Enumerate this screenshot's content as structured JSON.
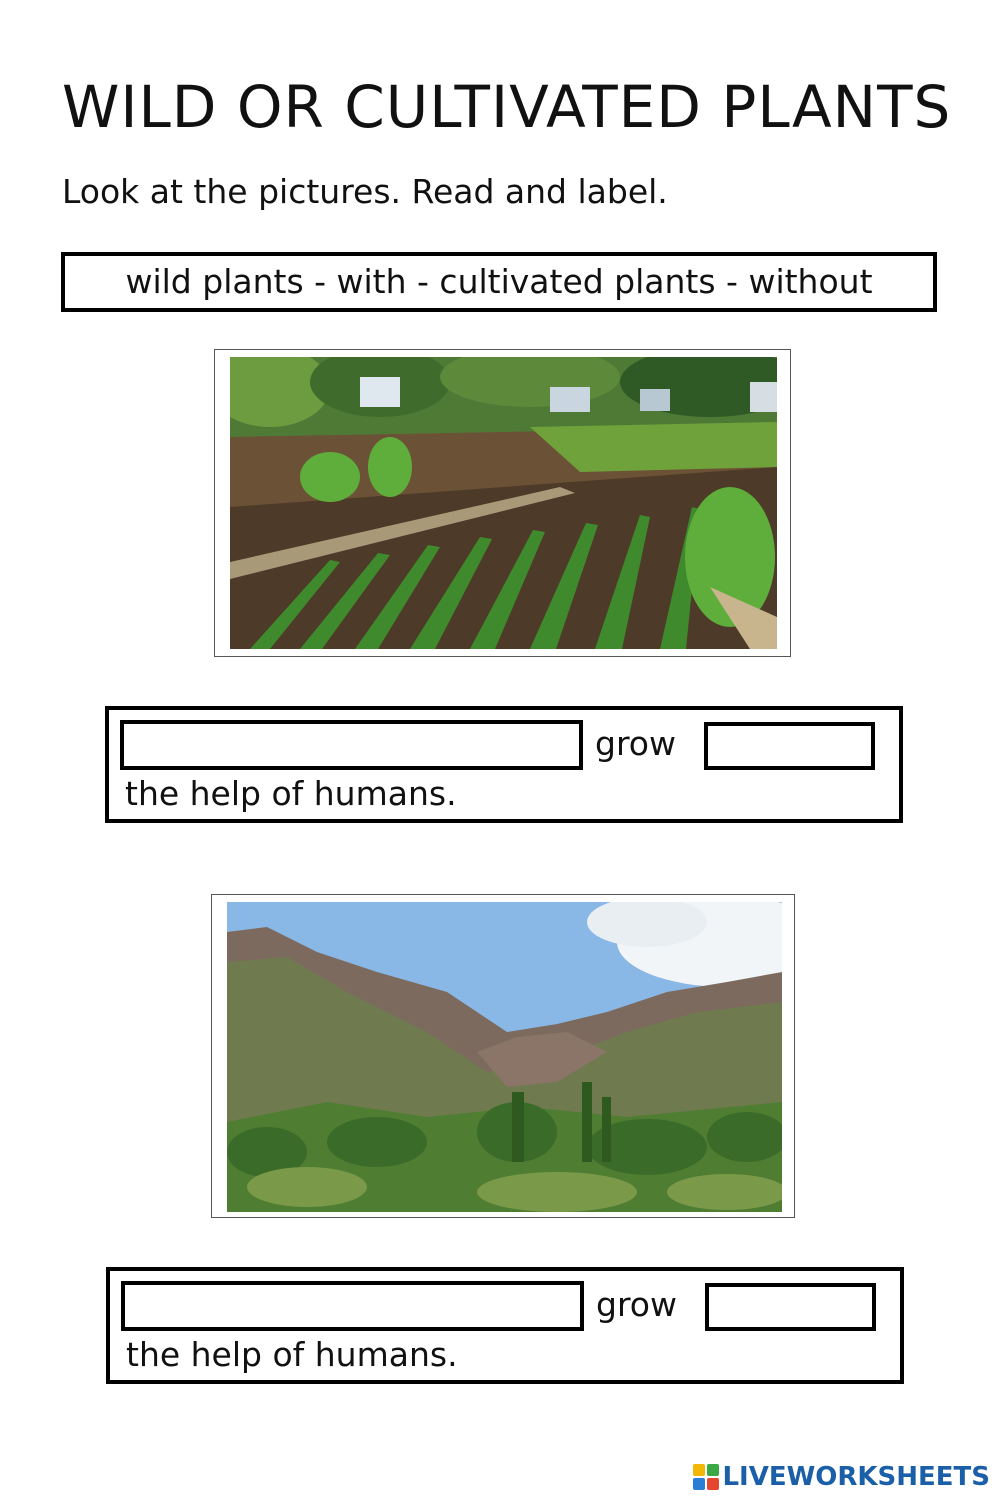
{
  "worksheet": {
    "title": "WILD OR CULTIVATED PLANTS",
    "instructions": "Look at the pictures. Read and label.",
    "word_bank": "wild plants - with - cultivated plants - without"
  },
  "exercises": [
    {
      "picture": "cultivated-vegetable-garden",
      "grow_word": "grow",
      "sentence_end": "the help of humans.",
      "blank_1_value": "",
      "blank_2_value": ""
    },
    {
      "picture": "wild-mountain-valley",
      "grow_word": "grow",
      "sentence_end": "the help of humans.",
      "blank_1_value": "",
      "blank_2_value": ""
    }
  ],
  "branding": {
    "icon": "liveworksheets-logo-icon",
    "text": "LIVEWORKSHEETS"
  }
}
